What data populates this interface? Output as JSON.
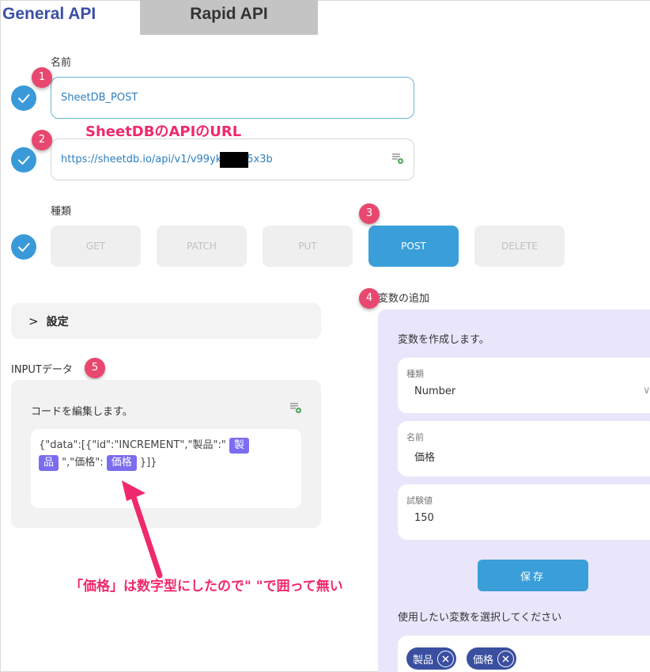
{
  "tabs": {
    "general": "General API",
    "rapid": "Rapid API"
  },
  "form": {
    "name_label": "名前",
    "name_value": "SheetDB_POST",
    "url_prefix": "https://sheetdb.io/api/v1/v99yk",
    "url_suffix": "5x3b",
    "type_label": "種類",
    "methods": [
      "GET",
      "PATCH",
      "PUT",
      "POST",
      "DELETE"
    ],
    "selected_method": "POST"
  },
  "settings": {
    "label": "設定"
  },
  "input_data": {
    "label": "INPUTデータ",
    "edit_caption": "コードを編集します。",
    "code_part1": "{\"data\":[{\"id\":\"INCREMENT\",\"製品\":\" ",
    "tag_product_top": "製",
    "tag_product_bottom": "品",
    "code_part2": " \",\"価格\": ",
    "tag_price": "価格",
    "code_part3": " }]}"
  },
  "variables": {
    "header": "変数の追加",
    "create_caption": "変数を作成します。",
    "fields": [
      {
        "caption": "種類",
        "value": "Number"
      },
      {
        "caption": "名前",
        "value": "価格"
      },
      {
        "caption": "試験値",
        "value": "150"
      }
    ],
    "save_label": "保存",
    "select_caption": "使用したい変数を選択してください",
    "chips": [
      "製品",
      "価格"
    ]
  },
  "annotations": {
    "badges": [
      "1",
      "2",
      "3",
      "4",
      "5"
    ],
    "url_note": "SheetDBのAPIのURL",
    "price_note": "「価格」は数字型にしたので\" \"で囲って無い"
  },
  "colors": {
    "accent_blue": "#3a9ed9",
    "brand_navy": "#3b4fa8",
    "annotation_pink": "#f0296e",
    "variable_tag": "#7b6cf0",
    "variable_panel": "#e9e6fb"
  }
}
